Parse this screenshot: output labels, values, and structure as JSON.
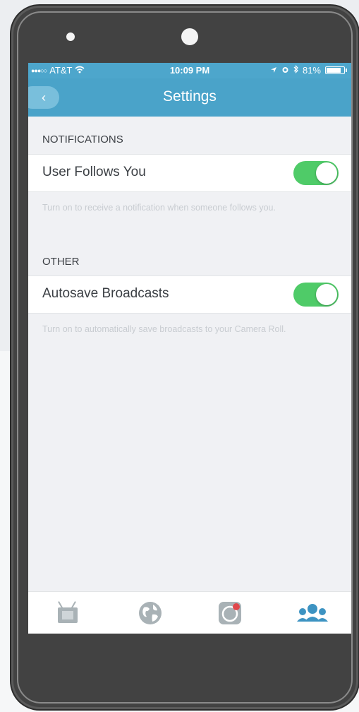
{
  "status_bar": {
    "signal": "●●●○○",
    "carrier": "AT&T",
    "time": "10:09 PM",
    "battery": "81%"
  },
  "nav": {
    "back_glyph": "‹",
    "title": "Settings"
  },
  "sections": [
    {
      "header": "NOTIFICATIONS",
      "row_label": "User Follows You",
      "toggle_on": true,
      "hint": "Turn on to receive a notification when someone follows you."
    },
    {
      "header": "OTHER",
      "row_label": "Autosave Broadcasts",
      "toggle_on": true,
      "hint": "Turn on to automatically save broadcasts to your Camera Roll."
    }
  ],
  "tabbar": {
    "tabs": [
      {
        "icon": "tv-icon",
        "active": false
      },
      {
        "icon": "globe-icon",
        "active": false
      },
      {
        "icon": "broadcast-icon",
        "active": false
      },
      {
        "icon": "people-icon",
        "active": true
      }
    ]
  },
  "colors": {
    "accent": "#4aa3c9",
    "toggle_on": "#4fcb68",
    "tab_inactive": "#a9b2b6",
    "tab_active": "#3d93c2",
    "broadcast_dot": "#e0474c"
  }
}
